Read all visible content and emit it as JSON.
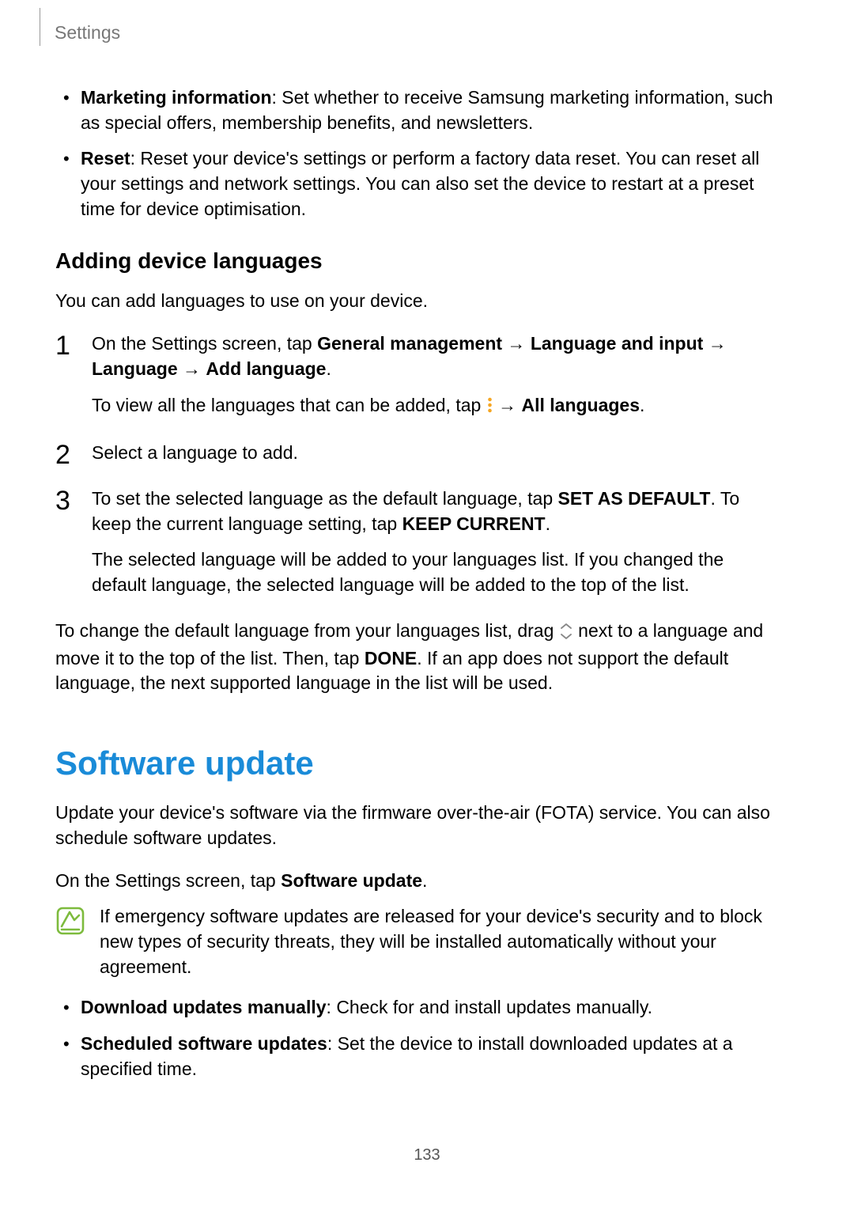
{
  "header": {
    "title": "Settings"
  },
  "bullets_top": [
    {
      "label": "Marketing information",
      "desc": ": Set whether to receive Samsung marketing information, such as special offers, membership benefits, and newsletters."
    },
    {
      "label": "Reset",
      "desc": ": Reset your device's settings or perform a factory data reset. You can reset all your settings and network settings. You can also set the device to restart at a preset time for device optimisation."
    }
  ],
  "subheading": "Adding device languages",
  "subheading_intro": "You can add languages to use on your device.",
  "steps": {
    "s1": {
      "pre": "On the Settings screen, tap ",
      "b1": "General management",
      "arrow1": " → ",
      "b2": "Language and input",
      "arrow2": " → ",
      "b3": "Language",
      "arrow3": " → ",
      "b4": "Add language",
      "post": ".",
      "sub_pre": "To view all the languages that can be added, tap ",
      "sub_arrow": " → ",
      "sub_b": "All languages",
      "sub_post": "."
    },
    "s2": {
      "text": "Select a language to add."
    },
    "s3": {
      "pre": "To set the selected language as the default language, tap ",
      "b1": "SET AS DEFAULT",
      "mid": ". To keep the current language setting, tap ",
      "b2": "KEEP CURRENT",
      "post": ".",
      "sub": "The selected language will be added to your languages list. If you changed the default language, the selected language will be added to the top of the list."
    }
  },
  "post_steps": {
    "pre": "To change the default language from your languages list, drag ",
    "mid": " next to a language and move it to the top of the list. Then, tap ",
    "b1": "DONE",
    "post": ". If an app does not support the default language, the next supported language in the list will be used."
  },
  "section": {
    "title": "Software update",
    "intro": "Update your device's software via the firmware over-the-air (FOTA) service. You can also schedule software updates.",
    "nav_pre": "On the Settings screen, tap ",
    "nav_b": "Software update",
    "nav_post": ".",
    "note": "If emergency software updates are released for your device's security and to block new types of security threats, they will be installed automatically without your agreement.",
    "bullets": [
      {
        "label": "Download updates manually",
        "desc": ": Check for and install updates manually."
      },
      {
        "label": "Scheduled software updates",
        "desc": ": Set the device to install downloaded updates at a specified time."
      }
    ]
  },
  "page_number": "133",
  "icons": {
    "more": "more-options-icon",
    "reorder": "reorder-handle-icon",
    "note": "note-memo-icon"
  },
  "colors": {
    "accent": "#1a8bd8",
    "icon_green": "#7dbb3d",
    "icon_orange": "#f5a623"
  }
}
